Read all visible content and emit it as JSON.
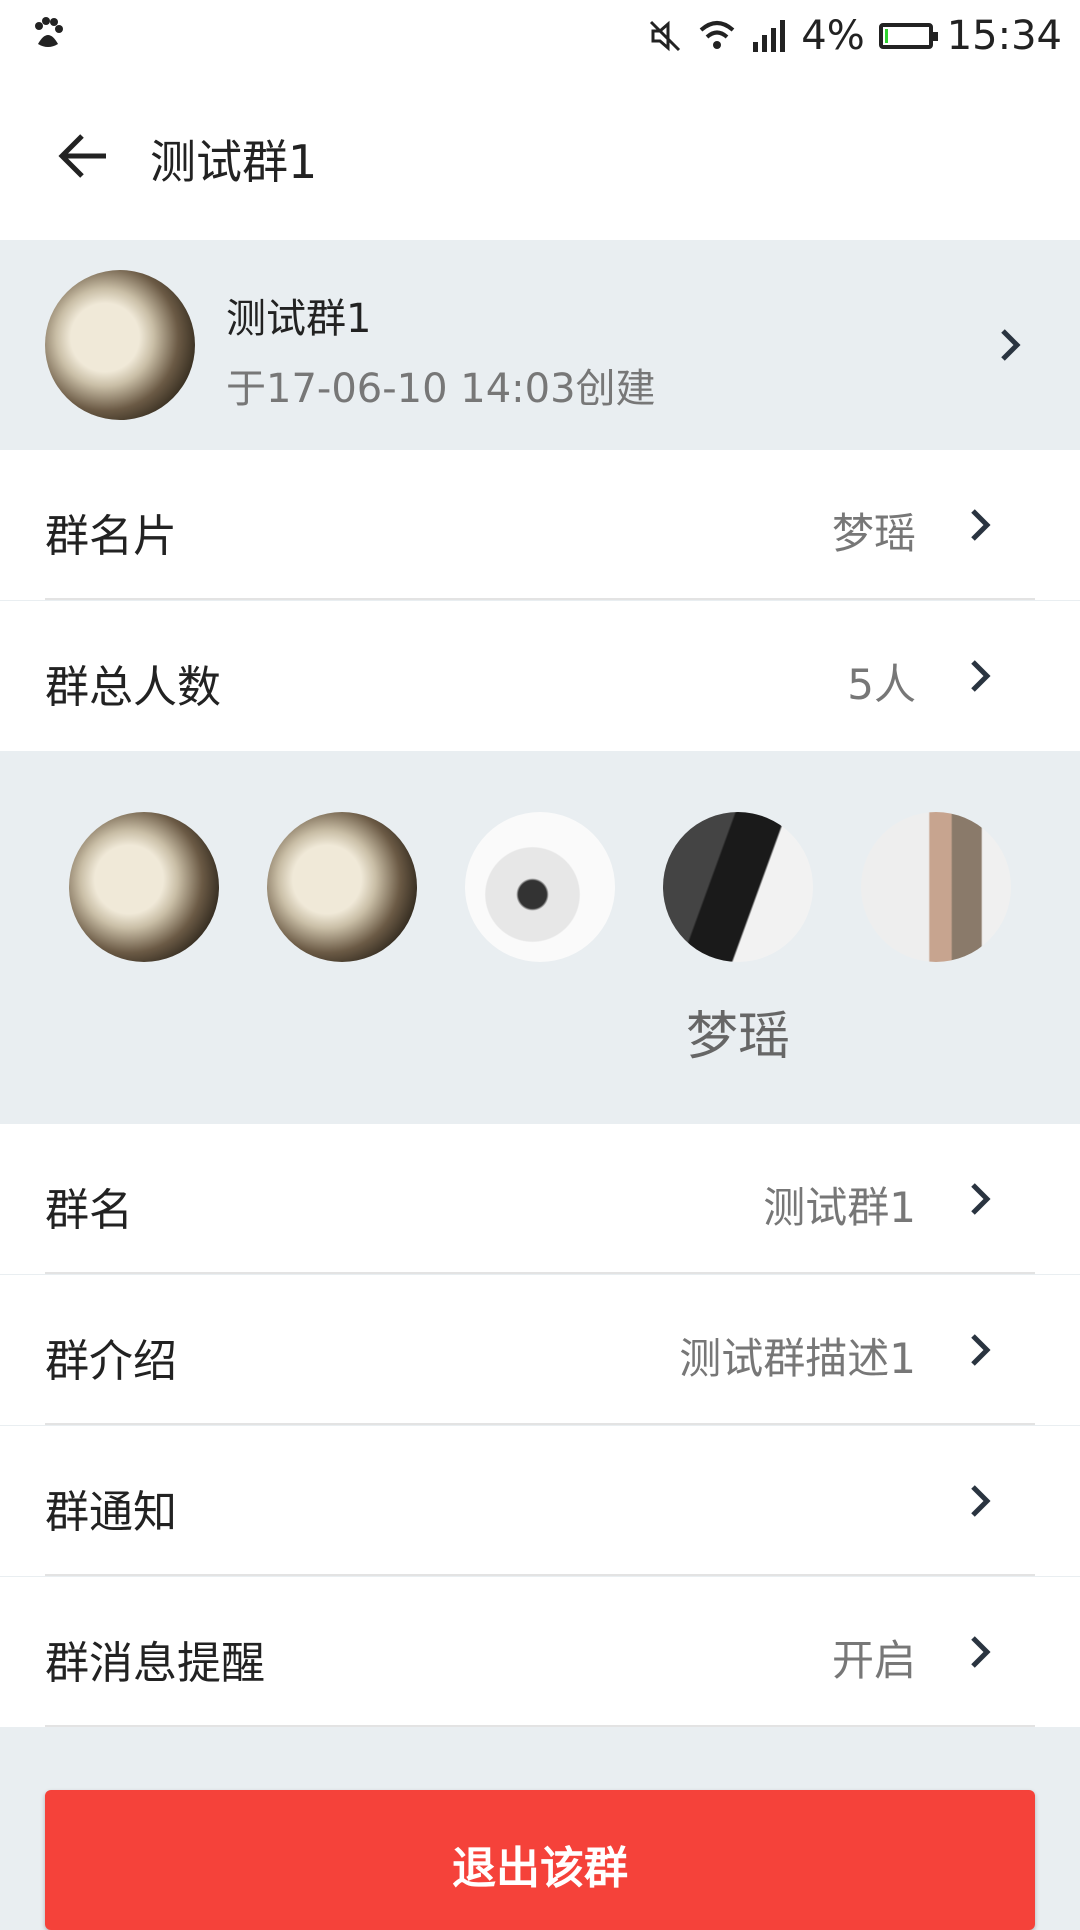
{
  "status_bar": {
    "left_icon": "baidu-paw-icon",
    "icons": [
      "mute-icon",
      "wifi-icon",
      "signal-icon"
    ],
    "battery_text": "4%",
    "battery_level": 0.04,
    "time": "15:34"
  },
  "app_bar": {
    "back_icon": "arrow-left-icon",
    "title": "测试群1"
  },
  "group_header": {
    "name": "测试群1",
    "created": "于17-06-10 14:03创建"
  },
  "rows_top": [
    {
      "label": "群名片",
      "value": "梦瑶"
    },
    {
      "label": "群总人数",
      "value": "5人"
    }
  ],
  "members": [
    {
      "name": ""
    },
    {
      "name": ""
    },
    {
      "name": ""
    },
    {
      "name": "梦瑶"
    },
    {
      "name": ""
    }
  ],
  "rows_bottom": [
    {
      "label": "群名",
      "value": "测试群1"
    },
    {
      "label": "群介绍",
      "value": "测试群描述1"
    },
    {
      "label": "群通知",
      "value": ""
    },
    {
      "label": "群消息提醒",
      "value": "开启"
    }
  ],
  "exit_button": {
    "label": "退出该群"
  },
  "colors": {
    "accent": "#f5423a",
    "background": "#e9eef1",
    "battery": "#2fd12f"
  }
}
